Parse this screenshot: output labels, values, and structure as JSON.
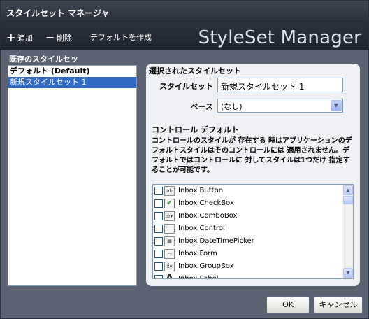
{
  "window": {
    "title": "スタイルセット マネージャ"
  },
  "toolbar": {
    "add_label": "追加",
    "delete_label": "削除",
    "create_default_label": "デフォルトを作成",
    "brand": "StyleSet Manager"
  },
  "existing": {
    "header": "既存のスタイルセッ",
    "items": [
      {
        "label": "デフォルト (Default)",
        "bold": true,
        "selected": false
      },
      {
        "label": "新規スタイルセット 1",
        "bold": false,
        "selected": true
      }
    ]
  },
  "selected_set": {
    "section_title": "選択されたスタイルセット",
    "styleset_label": "スタイルセット",
    "styleset_value": "新規スタイルセット 1",
    "base_label": "ベース",
    "base_value": "(なし)"
  },
  "control_defaults": {
    "title": "コントロール デフォルト",
    "description": "コントロールのスタイルが 存在する 時はアプリケーションのデフォルトスタイルはそのコントロールには 適用されません。デフォルトではコントロールに 対してスタイルは1つだけ 指定することが可能です。",
    "items": [
      {
        "label": "Inbox Button",
        "icon": "button-icon",
        "glyph": "ab",
        "checked": false
      },
      {
        "label": "Inbox CheckBox",
        "icon": "checkbox-icon",
        "glyph": "✔",
        "checked": false
      },
      {
        "label": "Inbox ComboBox",
        "icon": "combobox-icon",
        "glyph": "≡▾",
        "checked": false
      },
      {
        "label": "Inbox Control",
        "icon": "control-icon",
        "glyph": "",
        "checked": false
      },
      {
        "label": "Inbox DateTimePicker",
        "icon": "calendar-icon",
        "glyph": "▦",
        "checked": false
      },
      {
        "label": "Inbox Form",
        "icon": "form-icon",
        "glyph": "▭",
        "checked": false
      },
      {
        "label": "Inbox GroupBox",
        "icon": "groupbox-icon",
        "glyph": "xy",
        "checked": false
      },
      {
        "label": "Inbox Label",
        "icon": "label-icon",
        "glyph": "A",
        "checked": false
      }
    ]
  },
  "buttons": {
    "ok": "OK",
    "cancel": "キャンセル"
  },
  "colors": {
    "selection": "#316ac5",
    "panel": "#eef0f4",
    "toolbar": "#1f2530"
  }
}
